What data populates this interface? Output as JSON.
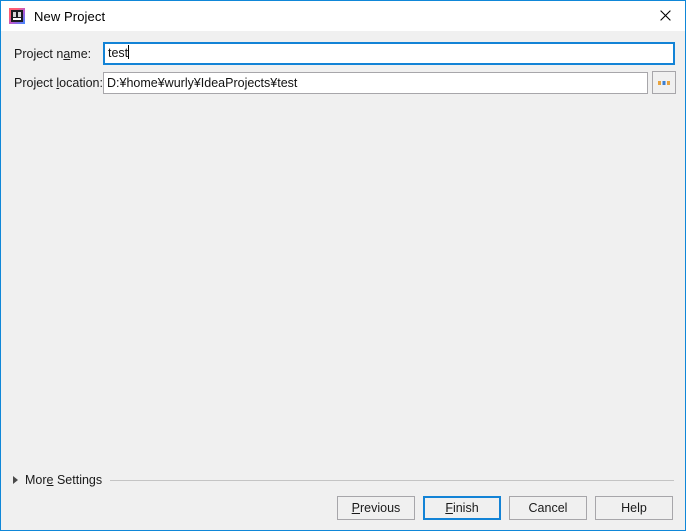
{
  "window": {
    "title": "New Project",
    "icon": "intellij-idea-icon",
    "close_label": "✕",
    "border_color": "#0f87d8",
    "titlebar_bg": "#ffffff",
    "content_bg": "#f0f0f0"
  },
  "form": {
    "name_field": {
      "label_before": "Project n",
      "label_mnemonic": "a",
      "label_after": "me:",
      "value": "test",
      "placeholder": "",
      "focused": true
    },
    "location_field": {
      "label_before": "Project ",
      "label_mnemonic": "l",
      "label_after": "ocation:",
      "value": "D:¥home¥wurly¥IdeaProjects¥test",
      "placeholder": "",
      "focused": false
    },
    "browse_button": {
      "name": "browse-ellipsis-icon",
      "tooltip": "..."
    }
  },
  "more_settings": {
    "label_before": "Mor",
    "label_mnemonic": "e",
    "label_after": " Settings",
    "expanded": false,
    "arrow": "chevron-right-icon"
  },
  "footer": {
    "buttons": [
      {
        "name": "previous-button",
        "before": "",
        "mnemonic": "P",
        "after": "revious",
        "default": false
      },
      {
        "name": "finish-button",
        "before": "",
        "mnemonic": "F",
        "after": "inish",
        "default": true
      },
      {
        "name": "cancel-button",
        "before": "Cancel",
        "mnemonic": "",
        "after": "",
        "default": false
      },
      {
        "name": "help-button",
        "before": "Help",
        "mnemonic": "",
        "after": "",
        "default": false
      }
    ]
  },
  "colors": {
    "accent": "#1383d6",
    "border": "#a7a6aa",
    "text": "#1a1a1a"
  }
}
